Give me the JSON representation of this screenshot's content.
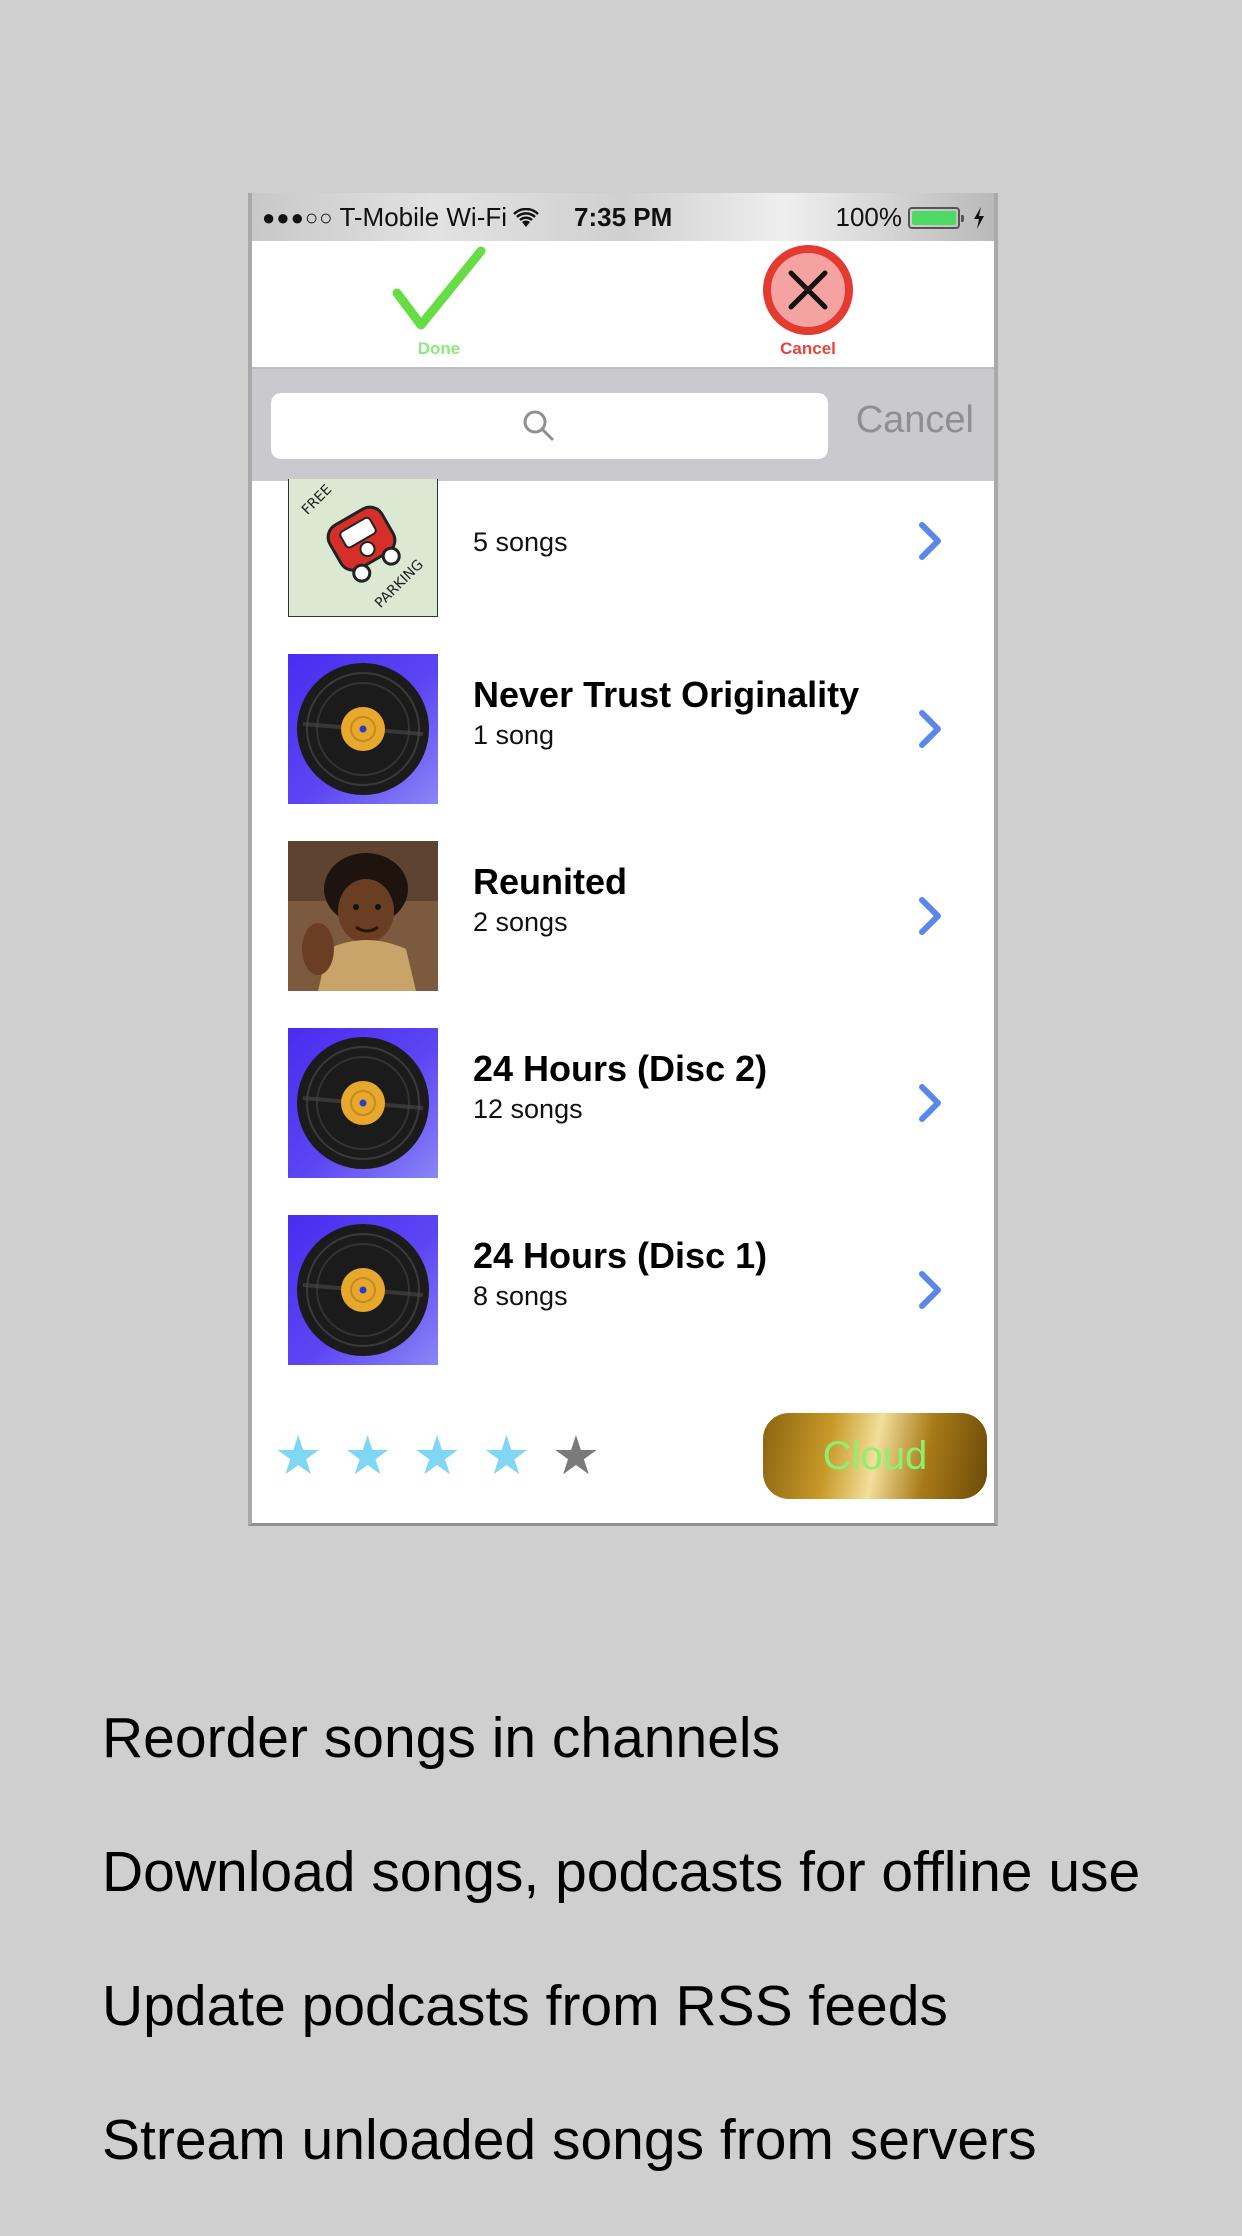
{
  "status_bar": {
    "signal": "●●●○○",
    "carrier": "T-Mobile Wi-Fi",
    "time": "7:35 PM",
    "battery": "100%",
    "battery_level": 1.0
  },
  "toolbar": {
    "done_label": "Done",
    "cancel_label": "Cancel",
    "done_color": "#66dd44",
    "cancel_color": "#e53a2f"
  },
  "search": {
    "placeholder": "",
    "cancel_label": "Cancel"
  },
  "albums": [
    {
      "title": "",
      "subtitle": "5 songs",
      "art": "free-parking"
    },
    {
      "title": "Never Trust Originality",
      "subtitle": "1 song",
      "art": "vinyl-record"
    },
    {
      "title": "Reunited",
      "subtitle": "2 songs",
      "art": "portrait-photo"
    },
    {
      "title": "24 Hours (Disc 2)",
      "subtitle": "12 songs",
      "art": "vinyl-record"
    },
    {
      "title": "24 Hours (Disc 1)",
      "subtitle": "8 songs",
      "art": "vinyl-record"
    }
  ],
  "rating": {
    "filled": 4,
    "total": 5,
    "filled_color": "#7fd6f5",
    "empty_color": "#7a7a7a"
  },
  "cloud_button": {
    "label": "Cloud"
  },
  "features": [
    "Reorder songs in channels",
    "Download songs, podcasts for offline use",
    "Update podcasts from RSS feeds",
    "Stream unloaded songs from servers"
  ]
}
